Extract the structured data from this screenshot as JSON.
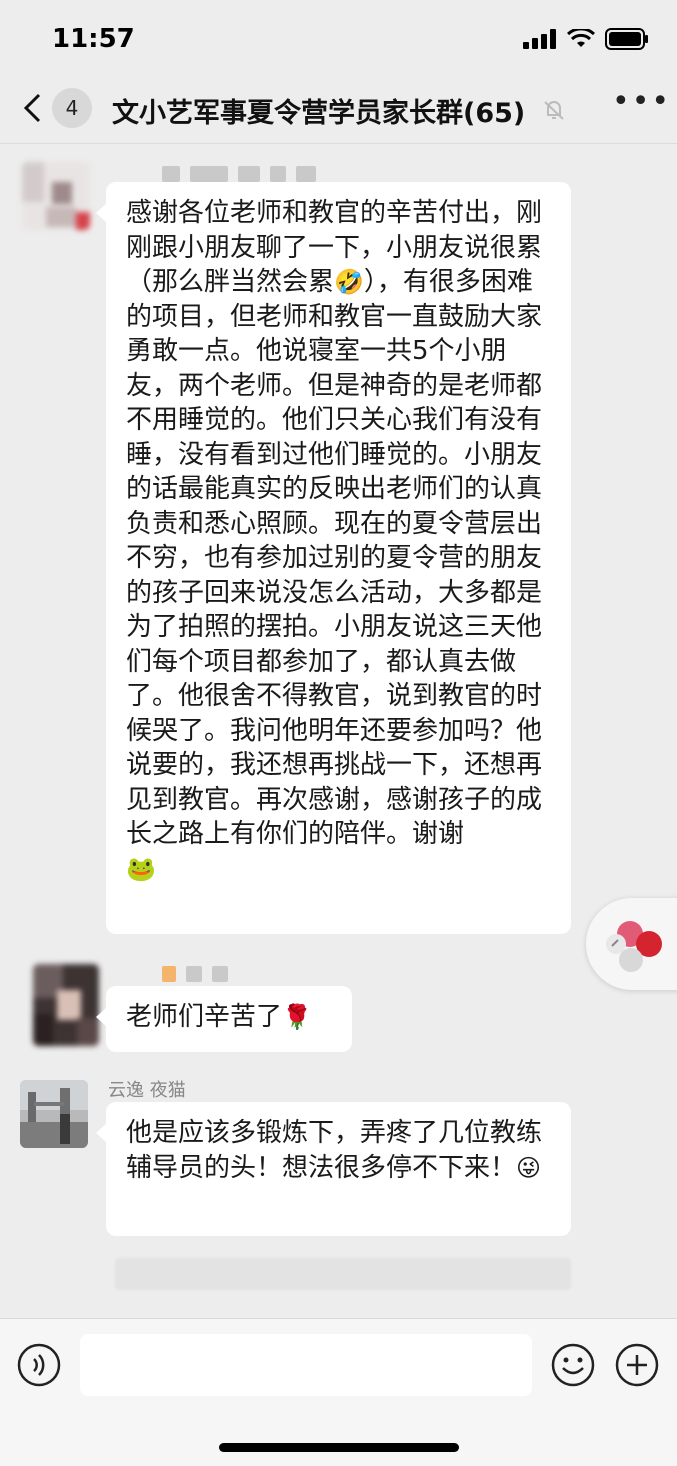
{
  "status": {
    "time": "11:57"
  },
  "nav": {
    "back_icon": "chevron-left-icon",
    "unread_count": "4",
    "title": "文小艺军事夏令营学员家长群(65)",
    "mute_icon": "bell-muted-icon",
    "more_label": "•••"
  },
  "messages": [
    {
      "sender": "",
      "text": "感谢各位老师和教官的辛苦付出，刚刚跟小朋友聊了一下，小朋友说很累（那么胖当然会累",
      "emoji1": "🤣",
      "text_cont": "），有很多困难的项目，但老师和教官一直鼓励大家勇敢一点。他说寝室一共5个小朋友，两个老师。但是神奇的是老师都不用睡觉的。他们只关心我们有没有睡，没有看到过他们睡觉的。小朋友的话最能真实的反映出老师们的认真负责和悉心照顾。现在的夏令营层出不穷，也有参加过别的夏令营的朋友的孩子回来说没怎么活动，大多都是为了拍照的摆拍。小朋友说这三天他们每个项目都参加了，都认真去做了。他很舍不得教官，说到教官的时候哭了。我问他明年还要参加吗？他说要的，我还想再挑战一下，还想再见到教官。再次感谢，感谢孩子的成长之路上有你们的陪伴。谢谢",
      "emoji2": "🐸"
    },
    {
      "sender": "",
      "text": "老师们辛苦了",
      "emoji": "🌹"
    },
    {
      "sender": "云逸 夜猫",
      "text": "他是应该多锻炼下，弄疼了几位教练辅导员的头！想法很多停不下来！",
      "emoji": "😜"
    }
  ],
  "input": {
    "voice_icon": "voice-icon",
    "emoji_icon": "smiley-icon",
    "plus_icon": "plus-icon"
  }
}
